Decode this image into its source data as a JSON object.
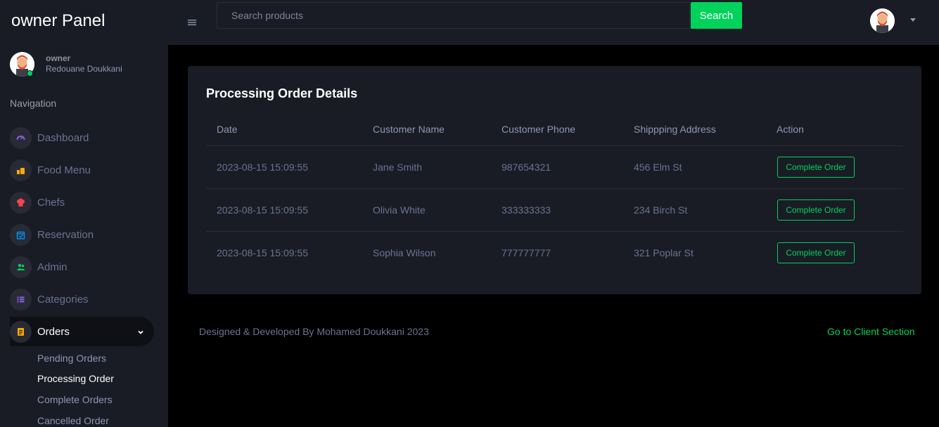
{
  "sidebar": {
    "brand": "owner Panel",
    "profile": {
      "role": "owner",
      "name": "Redouane Doukkani"
    },
    "nav_heading": "Navigation",
    "items": [
      {
        "label": "Dashboard",
        "icon": "speedometer-icon",
        "color": "#8f5fe8"
      },
      {
        "label": "Food Menu",
        "icon": "food-icon",
        "color": "#ffab00"
      },
      {
        "label": "Chefs",
        "icon": "chef-hat-icon",
        "color": "#fc424a"
      },
      {
        "label": "Reservation",
        "icon": "calendar-icon",
        "color": "#0090e7"
      },
      {
        "label": "Admin",
        "icon": "users-icon",
        "color": "#00d25b"
      },
      {
        "label": "Categories",
        "icon": "list-icon",
        "color": "#8f5fe8"
      },
      {
        "label": "Orders",
        "icon": "document-icon",
        "color": "#ffab00"
      }
    ],
    "orders_subitems": [
      {
        "label": "Pending Orders"
      },
      {
        "label": "Processing Order"
      },
      {
        "label": "Complete Orders"
      },
      {
        "label": "Cancelled Order"
      }
    ]
  },
  "topbar": {
    "search_placeholder": "Search products",
    "search_button": "Search"
  },
  "card": {
    "title": "Processing Order Details",
    "columns": [
      "Date",
      "Customer Name",
      "Customer Phone",
      "Shippping Address",
      "Action"
    ],
    "rows": [
      {
        "date": "2023-08-15 15:09:55",
        "name": "Jane Smith",
        "phone": "987654321",
        "address": "456 Elm St",
        "action": "Complete Order"
      },
      {
        "date": "2023-08-15 15:09:55",
        "name": "Olivia White",
        "phone": "333333333",
        "address": "234 Birch St",
        "action": "Complete Order"
      },
      {
        "date": "2023-08-15 15:09:55",
        "name": "Sophia Wilson",
        "phone": "777777777",
        "address": "321 Poplar St",
        "action": "Complete Order"
      }
    ]
  },
  "footer": {
    "credit": "Designed & Developed By Mohamed Doukkani 2023",
    "link": "Go to Client Section"
  },
  "colors": {
    "accent": "#00d25b",
    "sidebar_bg": "#191c24",
    "page_bg": "#000000"
  }
}
